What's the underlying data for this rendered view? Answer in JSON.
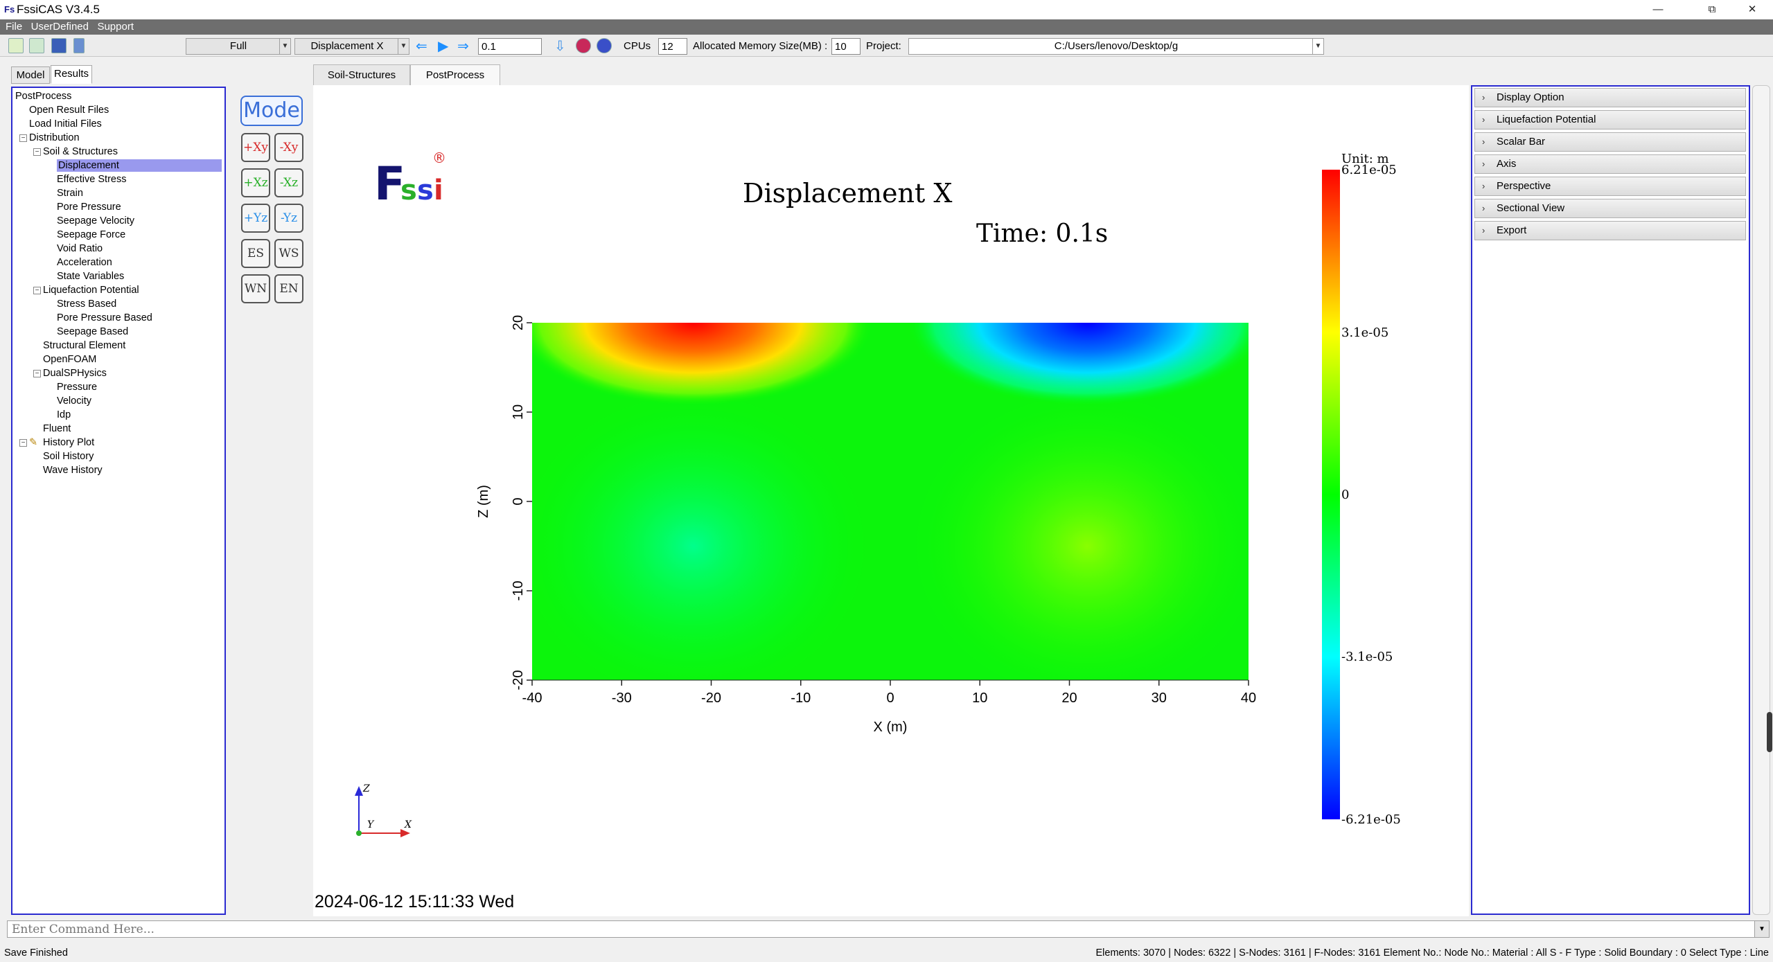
{
  "window": {
    "title": "FssiCAS V3.4.5",
    "logo_text": "Fs",
    "minimize": "—",
    "maximize": "⧉",
    "close": "✕"
  },
  "menu": [
    "File",
    "UserDefined",
    "Support"
  ],
  "toolbar": {
    "view_mode": "Full",
    "result_type": "Displacement X",
    "time_value": "0.1",
    "cpus_label": "CPUs",
    "cpus_value": "12",
    "memory_label": "Allocated Memory Size(MB) :",
    "memory_value": "10",
    "project_label": "Project:",
    "project_path": "C:/Users/lenovo/Desktop/g"
  },
  "left_tabs": [
    "Model",
    "Results"
  ],
  "tree": [
    {
      "label": "PostProcess",
      "level": 0,
      "expander": ""
    },
    {
      "label": "Open Result Files",
      "level": 1,
      "expander": ""
    },
    {
      "label": "Load Initial Files",
      "level": 1,
      "expander": ""
    },
    {
      "label": "Distribution",
      "level": 1,
      "expander": "−"
    },
    {
      "label": "Soil & Structures",
      "level": 2,
      "expander": "−"
    },
    {
      "label": "Displacement",
      "level": 3,
      "expander": "",
      "selected": true
    },
    {
      "label": "Effective Stress",
      "level": 3,
      "expander": ""
    },
    {
      "label": "Strain",
      "level": 3,
      "expander": ""
    },
    {
      "label": "Pore Pressure",
      "level": 3,
      "expander": ""
    },
    {
      "label": "Seepage Velocity",
      "level": 3,
      "expander": ""
    },
    {
      "label": "Seepage Force",
      "level": 3,
      "expander": ""
    },
    {
      "label": "Void Ratio",
      "level": 3,
      "expander": ""
    },
    {
      "label": "Acceleration",
      "level": 3,
      "expander": ""
    },
    {
      "label": "State Variables",
      "level": 3,
      "expander": ""
    },
    {
      "label": "Liquefaction Potential",
      "level": 2,
      "expander": "−"
    },
    {
      "label": "Stress Based",
      "level": 3,
      "expander": ""
    },
    {
      "label": "Pore Pressure Based",
      "level": 3,
      "expander": ""
    },
    {
      "label": "Seepage Based",
      "level": 3,
      "expander": ""
    },
    {
      "label": "Structural Element",
      "level": 2,
      "expander": ""
    },
    {
      "label": "OpenFOAM",
      "level": 2,
      "expander": ""
    },
    {
      "label": "DualSPHysics",
      "level": 2,
      "expander": "−"
    },
    {
      "label": "Pressure",
      "level": 3,
      "expander": ""
    },
    {
      "label": "Velocity",
      "level": 3,
      "expander": ""
    },
    {
      "label": "Idp",
      "level": 3,
      "expander": ""
    },
    {
      "label": "Fluent",
      "level": 2,
      "expander": ""
    },
    {
      "label": "History Plot",
      "level": 1,
      "expander": "−",
      "pencil": true
    },
    {
      "label": "Soil History",
      "level": 2,
      "expander": ""
    },
    {
      "label": "Wave History",
      "level": 2,
      "expander": ""
    }
  ],
  "tools": {
    "mode": "Mode",
    "view_buttons": [
      {
        "left": "+Xy",
        "right": "-Xy"
      },
      {
        "left": "+Xz",
        "right": "-Xz"
      },
      {
        "left": "+Yz",
        "right": "-Yz"
      },
      {
        "left": "ES",
        "right": "WS"
      },
      {
        "left": "WN",
        "right": "EN"
      }
    ]
  },
  "center_tabs": [
    "Soil-Structures",
    "PostProcess"
  ],
  "viewport": {
    "logo": {
      "f": "F",
      "s1": "s",
      "s2": "s",
      "i": "i",
      "reg": "®"
    },
    "title": "Displacement X",
    "time": "Time: 0.1s",
    "timestamp": "2024-06-12 15:11:33 Wed",
    "axes_triad": {
      "z": "Z",
      "y": "Y",
      "x": "X"
    }
  },
  "chart_data": {
    "type": "heatmap",
    "title": "Displacement X",
    "subtitle": "Time: 0.1s",
    "xlabel": "X (m)",
    "ylabel": "Z (m)",
    "xlim": [
      -40,
      40
    ],
    "ylim": [
      -20,
      20
    ],
    "x_ticks": [
      "-40",
      "-30",
      "-20",
      "-10",
      "0",
      "10",
      "20",
      "30",
      "40"
    ],
    "y_ticks": [
      "20",
      "10",
      "0",
      "-10",
      "-20"
    ],
    "colorbar": {
      "unit_label": "Unit:   m",
      "max": 6.21e-05,
      "min": -6.21e-05,
      "tick_labels": [
        "6.21e-05",
        "3.1e-05",
        "0",
        "-3.1e-05",
        "-6.21e-05"
      ],
      "colors": [
        "#ff0000",
        "#ffff00",
        "#00ff00",
        "#00ffff",
        "#0000ff"
      ]
    },
    "features": [
      {
        "x": -22,
        "z": 20,
        "value": 6.21e-05
      },
      {
        "x": 22,
        "z": 20,
        "value": -6.21e-05
      },
      {
        "x": -22,
        "z": -5,
        "value": -1.2e-05
      },
      {
        "x": 22,
        "z": -5,
        "value": 1.2e-05
      }
    ]
  },
  "right_panel": [
    "Display Option",
    "Liquefaction Potential",
    "Scalar Bar",
    "Axis",
    "Perspective",
    "Sectional View",
    "Export"
  ],
  "side_toggle": "»",
  "command": {
    "placeholder": "Enter Command Here..."
  },
  "status": {
    "left": "Save Finished",
    "right": "Elements: 3070 | Nodes: 6322 | S-Nodes: 3161 | F-Nodes: 3161 Element No.:    Node No.:    Material :  All    S - F Type :  Solid    Boundary :  0    Select Type :  Line"
  }
}
